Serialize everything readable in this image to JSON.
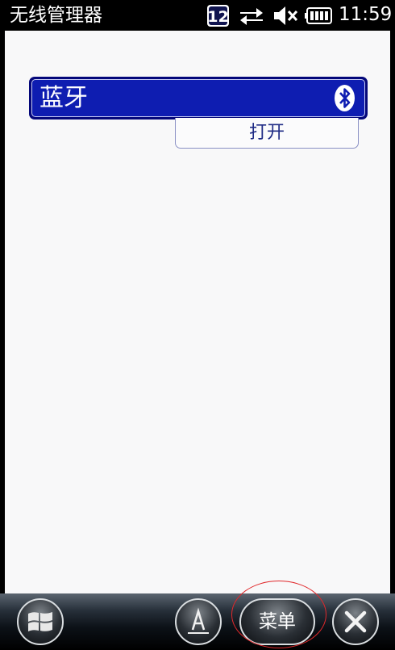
{
  "status_bar": {
    "app_title": "无线管理器",
    "badge_number": "12",
    "time": "11:59",
    "icons": [
      "badge-12-icon",
      "sync-arrows-icon",
      "volume-muted-icon",
      "battery-icon"
    ]
  },
  "bluetooth": {
    "label": "蓝牙",
    "state": "打开",
    "icon": "bluetooth-icon"
  },
  "softkeys": {
    "menu_label": "菜单",
    "start_icon": "windows-flag-icon",
    "keyboard_icon": "keyboard-a-icon",
    "close_icon": "close-icon"
  },
  "colors": {
    "card_bg": "#0e1db1",
    "card_border": "#04077a",
    "state_text": "#1f2b85",
    "highlight": "#e0282b"
  }
}
